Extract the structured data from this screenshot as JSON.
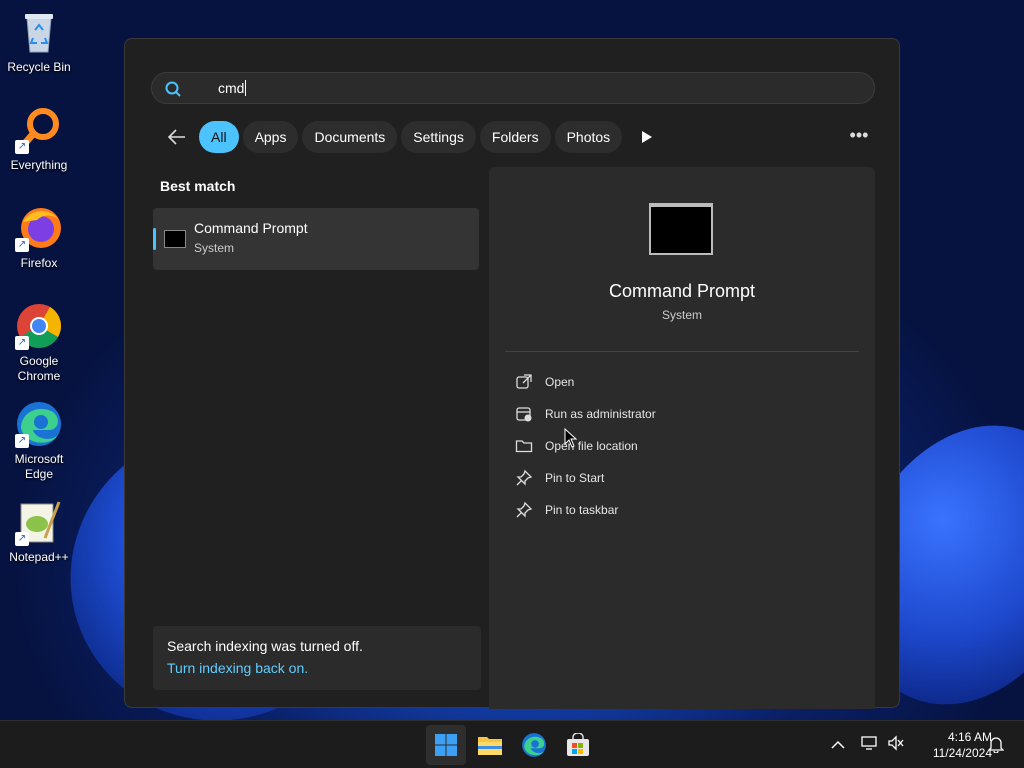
{
  "desktop": {
    "icons": [
      {
        "label": "Recycle Bin",
        "icon": "recycle-bin-icon"
      },
      {
        "label": "Everything",
        "icon": "everything-search-icon"
      },
      {
        "label": "Firefox",
        "icon": "firefox-icon"
      },
      {
        "label": "Google Chrome",
        "icon": "chrome-icon"
      },
      {
        "label": "Microsoft Edge",
        "icon": "edge-icon"
      },
      {
        "label": "Notepad++",
        "icon": "notepadpp-icon"
      }
    ]
  },
  "search": {
    "query": "cmd",
    "back_icon": "back-arrow-icon",
    "filters": [
      "All",
      "Apps",
      "Documents",
      "Settings",
      "Folders",
      "Photos"
    ],
    "active_filter": "All",
    "more_icon": "more-horizontal-icon"
  },
  "results": {
    "section_label": "Best match",
    "best": {
      "title": "Command Prompt",
      "subtitle": "System"
    }
  },
  "detail": {
    "title": "Command Prompt",
    "subtitle": "System",
    "actions": [
      {
        "label": "Open",
        "icon": "open-external-icon"
      },
      {
        "label": "Run as administrator",
        "icon": "shield-admin-icon"
      },
      {
        "label": "Open file location",
        "icon": "folder-icon"
      },
      {
        "label": "Pin to Start",
        "icon": "pin-icon"
      },
      {
        "label": "Pin to taskbar",
        "icon": "pin-icon"
      }
    ]
  },
  "indexing": {
    "message": "Search indexing was turned off.",
    "link": "Turn indexing back on."
  },
  "taskbar": {
    "apps": [
      "start-icon",
      "file-explorer-icon",
      "edge-icon",
      "store-icon"
    ],
    "time": "4:16 AM",
    "date": "11/24/2024"
  },
  "colors": {
    "accent": "#4cc2ff",
    "link": "#60cdff",
    "panel": "#202020"
  }
}
